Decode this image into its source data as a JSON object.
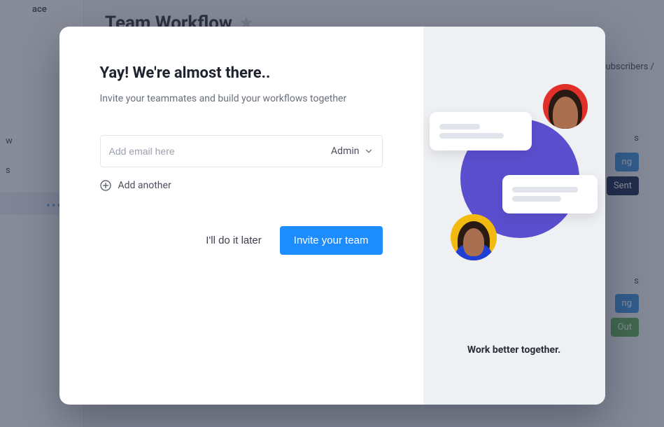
{
  "background": {
    "page_title": "Team Workflow",
    "sidebar_fragment_top": "ace",
    "sidebar_item_w": "w",
    "sidebar_item_s": "s",
    "right_text_subscribers": "ubscribers /",
    "right_text_s": "s",
    "pill_ng_1": "ng",
    "pill_sent": "Sent",
    "pill_ng_2": "ng",
    "pill_out": "Out"
  },
  "modal": {
    "title": "Yay! We're almost there..",
    "subtitle": "Invite your teammates and build your workflows together",
    "email_placeholder": "Add email here",
    "role_selected": "Admin",
    "add_another_label": "Add another",
    "later_button": "I'll do it later",
    "invite_button": "Invite your team"
  },
  "right_panel": {
    "tagline": "Work better together."
  }
}
